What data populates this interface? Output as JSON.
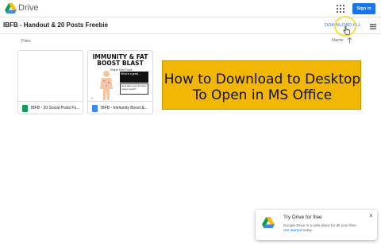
{
  "header": {
    "brand": "Drive",
    "signin_label": "Sign in",
    "apps_icon": "apps-grid-icon"
  },
  "title_bar": {
    "title": "IBFB - Handout & 20 Posts Freebie",
    "download_all": "DOWNLOAD ALL",
    "view_icon": "list-view-icon"
  },
  "section": {
    "files_label": "Files",
    "sort_label": "Name",
    "sort_icon": "arrow-up-icon"
  },
  "files": [
    {
      "name": "IBFB - 20 Social Posts Fo...",
      "type": "sheet"
    },
    {
      "name": "IBFB - Immunity Boost &...",
      "type": "doc"
    }
  ],
  "thumbnail": {
    "headline_1": "IMMUNITY & FAT",
    "headline_2": "BOOST BLAST",
    "tagline": "Simple Short Guide",
    "box_1": "What is a great...",
    "box_2": "How does your immune system work?",
    "footer": "©"
  },
  "banner": {
    "line_1": "How to Download to Desktop",
    "line_2": "To Open in MS Office",
    "color": "#f2b705"
  },
  "toast": {
    "title": "Try Drive for free",
    "body_1": "Google Drive is a safe place for all your files.",
    "link": "Get started",
    "body_2": " today.",
    "close": "×"
  },
  "colors": {
    "accent": "#1a73e8",
    "highlight": "#f4e04d"
  }
}
